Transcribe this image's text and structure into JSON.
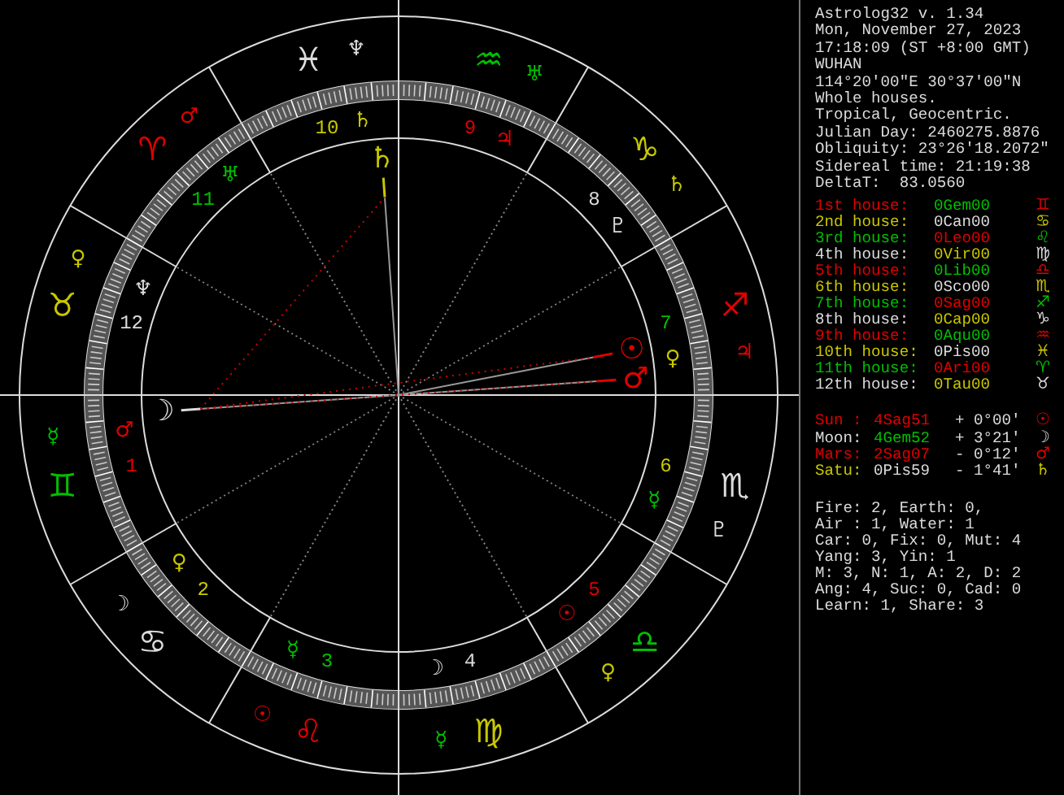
{
  "chart": {
    "signs": [
      {
        "glyph": "♐",
        "color": "#e00000",
        "ruler": {
          "glyph": "♃",
          "color": "#e00000"
        }
      },
      {
        "glyph": "♑",
        "color": "#c8c800",
        "ruler": {
          "glyph": "♄",
          "color": "#c8c800"
        }
      },
      {
        "glyph": "♒",
        "color": "#00c000",
        "ruler": {
          "glyph": "♅",
          "color": "#00c000"
        }
      },
      {
        "glyph": "♓",
        "color": "#dcdcdc",
        "ruler": {
          "glyph": "♆",
          "color": "#dcdcdc"
        }
      },
      {
        "glyph": "♈",
        "color": "#e00000",
        "ruler": {
          "glyph": "♂",
          "color": "#e00000"
        }
      },
      {
        "glyph": "♉",
        "color": "#c8c800",
        "ruler": {
          "glyph": "♀",
          "color": "#c8c800"
        }
      },
      {
        "glyph": "♊",
        "color": "#00c000",
        "ruler": {
          "glyph": "☿",
          "color": "#00c000"
        }
      },
      {
        "glyph": "♋",
        "color": "#dcdcdc",
        "ruler": {
          "glyph": "☽",
          "color": "#dcdcdc"
        }
      },
      {
        "glyph": "♌",
        "color": "#e00000",
        "ruler": {
          "glyph": "☉",
          "color": "#e00000"
        }
      },
      {
        "glyph": "♍",
        "color": "#c8c800",
        "ruler": {
          "glyph": "☿",
          "color": "#00c000"
        }
      },
      {
        "glyph": "♎",
        "color": "#00c000",
        "ruler": {
          "glyph": "♀",
          "color": "#c8c800"
        }
      },
      {
        "glyph": "♏",
        "color": "#dcdcdc",
        "ruler": {
          "glyph": "♇",
          "color": "#dcdcdc"
        }
      }
    ],
    "houses": [
      {
        "number": "1",
        "color": "#e00000",
        "ruler": {
          "glyph": "♂",
          "color": "#e00000"
        },
        "planets": [
          {
            "glyph": "☽",
            "color": "#dcdcdc"
          }
        ]
      },
      {
        "number": "2",
        "color": "#c8c800",
        "ruler": {
          "glyph": "♀",
          "color": "#c8c800"
        }
      },
      {
        "number": "3",
        "color": "#00c000",
        "ruler": {
          "glyph": "☿",
          "color": "#00c000"
        }
      },
      {
        "number": "4",
        "color": "#dcdcdc",
        "ruler": {
          "glyph": "☽",
          "color": "#dcdcdc"
        }
      },
      {
        "number": "5",
        "color": "#e00000",
        "ruler": {
          "glyph": "☉",
          "color": "#e00000"
        }
      },
      {
        "number": "6",
        "color": "#c8c800",
        "ruler": {
          "glyph": "☿",
          "color": "#00c000"
        }
      },
      {
        "number": "7",
        "color": "#00c000",
        "ruler": {
          "glyph": "♀",
          "color": "#c8c800"
        },
        "planets": [
          {
            "glyph": "☉",
            "color": "#e00000"
          },
          {
            "glyph": "♂",
            "color": "#e00000"
          }
        ]
      },
      {
        "number": "8",
        "color": "#dcdcdc",
        "ruler": {
          "glyph": "♇",
          "color": "#dcdcdc"
        }
      },
      {
        "number": "9",
        "color": "#e00000",
        "ruler": {
          "glyph": "♃",
          "color": "#e00000"
        }
      },
      {
        "number": "10",
        "color": "#c8c800",
        "ruler": {
          "glyph": "♄",
          "color": "#c8c800"
        },
        "planets": [
          {
            "glyph": "♄",
            "color": "#c8c800"
          }
        ]
      },
      {
        "number": "11",
        "color": "#00c000",
        "ruler": {
          "glyph": "♅",
          "color": "#00c000"
        }
      },
      {
        "number": "12",
        "color": "#dcdcdc",
        "ruler": {
          "glyph": "♆",
          "color": "#dcdcdc"
        }
      }
    ]
  },
  "info": [
    "Astrolog32 v. 1.34",
    "Mon, November 27, 2023",
    "17:18:09 (ST +8:00 GMT)",
    "WUHAN",
    "114°20'00\"E 30°37'00\"N",
    "Whole houses.",
    "Tropical, Geocentric.",
    "Julian Day: 2460275.8876",
    "Obliquity: 23°26'18.2072\"",
    "Sidereal time: 21:19:38",
    "DeltaT:  83.0560"
  ],
  "house_table": [
    {
      "label": "1st house:",
      "position": {
        "text": "0Gem00",
        "color": "#00c000"
      },
      "glyph": "♊",
      "color": "#e00000"
    },
    {
      "label": "2nd house:",
      "position": {
        "text": "0Can00",
        "color": "#dcdcdc"
      },
      "glyph": "♋",
      "color": "#c8c800"
    },
    {
      "label": "3rd house:",
      "position": {
        "text": "0Leo00",
        "color": "#e00000"
      },
      "glyph": "♌",
      "color": "#00c000"
    },
    {
      "label": "4th house:",
      "position": {
        "text": "0Vir00",
        "color": "#c8c800"
      },
      "glyph": "♍",
      "color": "#dcdcdc"
    },
    {
      "label": "5th house:",
      "position": {
        "text": "0Lib00",
        "color": "#00c000"
      },
      "glyph": "♎",
      "color": "#e00000"
    },
    {
      "label": "6th house:",
      "position": {
        "text": "0Sco00",
        "color": "#dcdcdc"
      },
      "glyph": "♏",
      "color": "#c8c800"
    },
    {
      "label": "7th house:",
      "position": {
        "text": "0Sag00",
        "color": "#e00000"
      },
      "glyph": "♐",
      "color": "#00c000"
    },
    {
      "label": "8th house:",
      "position": {
        "text": "0Cap00",
        "color": "#c8c800"
      },
      "glyph": "♑",
      "color": "#dcdcdc"
    },
    {
      "label": "9th house:",
      "position": {
        "text": "0Aqu00",
        "color": "#00c000"
      },
      "glyph": "♒",
      "color": "#e00000"
    },
    {
      "label": "10th house:",
      "position": {
        "text": "0Pis00",
        "color": "#dcdcdc"
      },
      "glyph": "♓",
      "color": "#c8c800"
    },
    {
      "label": "11th house:",
      "position": {
        "text": "0Ari00",
        "color": "#e00000"
      },
      "glyph": "♈",
      "color": "#00c000"
    },
    {
      "label": "12th house:",
      "position": {
        "text": "0Tau00",
        "color": "#c8c800"
      },
      "glyph": "♉",
      "color": "#dcdcdc"
    }
  ],
  "planet_table": [
    {
      "name": "Sun :",
      "position": {
        "text": "4Sag51",
        "color": "#e00000"
      },
      "offset": "+ 0°00'",
      "glyph": "☉",
      "color": "#e00000"
    },
    {
      "name": "Moon:",
      "position": {
        "text": "4Gem52",
        "color": "#00c000"
      },
      "offset": "+ 3°21'",
      "glyph": "☽",
      "color": "#dcdcdc"
    },
    {
      "name": "Mars:",
      "position": {
        "text": "2Sag07",
        "color": "#e00000"
      },
      "offset": "- 0°12'",
      "glyph": "♂",
      "color": "#e00000"
    },
    {
      "name": "Satu:",
      "position": {
        "text": "0Pis59",
        "color": "#dcdcdc"
      },
      "offset": "- 1°41'",
      "glyph": "♄",
      "color": "#c8c800"
    }
  ],
  "stats": [
    "Fire: 2, Earth: 0,",
    "Air : 1, Water: 1",
    "Car: 0, Fix: 0, Mut: 4",
    "Yang: 3, Yin: 1",
    "M: 3, N: 1, A: 2, D: 2",
    "Ang: 4, Suc: 0, Cad: 0",
    "Learn: 1, Share: 3"
  ]
}
